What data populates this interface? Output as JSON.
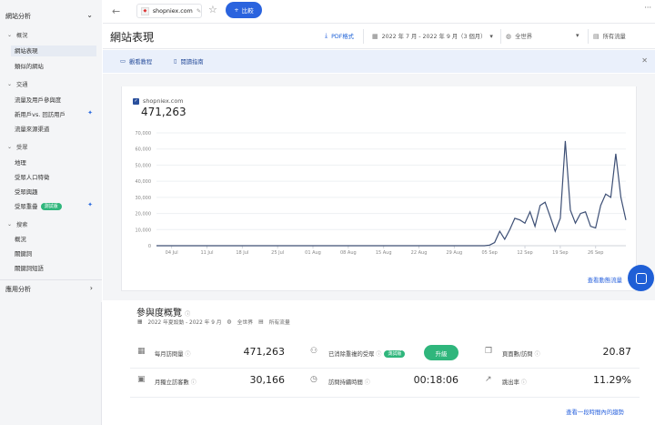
{
  "sidebar": {
    "header": "網站分析",
    "sections": [
      {
        "title": "概況",
        "items": [
          "網站表現",
          "類似的網站"
        ]
      },
      {
        "title": "交通",
        "items": [
          "流量及用戶參與度",
          "新用戶vs. 回訪用戶",
          "流量來源渠道"
        ]
      },
      {
        "title": "受眾",
        "items": [
          "地理",
          "受眾人口特徵",
          "受眾興趣",
          "受眾重疊"
        ]
      },
      {
        "title": "搜索",
        "items": [
          "概況",
          "關鍵詞",
          "關鍵詞短語"
        ]
      }
    ],
    "new_badge": "測試版",
    "footer": "應用分析"
  },
  "topbar": {
    "domain": "shopniex.com",
    "compare_label": "比較",
    "more": "···"
  },
  "titlebar": {
    "title": "網站表現",
    "pdf": "PDF格式",
    "date_range": "2022 年 7 月 - 2022 年 9 月（3 個月）",
    "region": "全世界",
    "traffic": "所有流量"
  },
  "infobar": {
    "tutorial": "觀看教程",
    "guide": "閱讀指南"
  },
  "chart": {
    "legend": "shopniex.com",
    "total": "471,263",
    "link": "查看動態流量"
  },
  "chart_data": {
    "type": "line",
    "series": [
      {
        "name": "shopniex.com"
      }
    ],
    "x_tick_labels": [
      "04 Jul",
      "11 Jul",
      "18 Jul",
      "25 Jul",
      "01 Aug",
      "08 Aug",
      "15 Aug",
      "22 Aug",
      "29 Aug",
      "05 Sep",
      "12 Sep",
      "19 Sep",
      "26 Sep"
    ],
    "y_tick_labels": [
      "0",
      "10,000",
      "20,000",
      "30,000",
      "40,000",
      "50,000",
      "60,000",
      "70,000"
    ],
    "ylim": [
      0,
      70000
    ],
    "x_start": "2022-07-01",
    "x_end": "2022-09-30",
    "points": [
      [
        "2022-07-01",
        0
      ],
      [
        "2022-09-04",
        0
      ],
      [
        "2022-09-05",
        400
      ],
      [
        "2022-09-06",
        2000
      ],
      [
        "2022-09-07",
        9000
      ],
      [
        "2022-09-08",
        4000
      ],
      [
        "2022-09-09",
        10000
      ],
      [
        "2022-09-10",
        17000
      ],
      [
        "2022-09-11",
        16000
      ],
      [
        "2022-09-12",
        14000
      ],
      [
        "2022-09-13",
        21000
      ],
      [
        "2022-09-14",
        12000
      ],
      [
        "2022-09-15",
        25000
      ],
      [
        "2022-09-16",
        27000
      ],
      [
        "2022-09-17",
        18000
      ],
      [
        "2022-09-18",
        9000
      ],
      [
        "2022-09-19",
        17000
      ],
      [
        "2022-09-20",
        65000
      ],
      [
        "2022-09-21",
        22000
      ],
      [
        "2022-09-22",
        14000
      ],
      [
        "2022-09-23",
        20000
      ],
      [
        "2022-09-24",
        21000
      ],
      [
        "2022-09-25",
        12000
      ],
      [
        "2022-09-26",
        11000
      ],
      [
        "2022-09-27",
        25000
      ],
      [
        "2022-09-28",
        32000
      ],
      [
        "2022-09-29",
        30000
      ],
      [
        "2022-09-30",
        57000
      ],
      [
        "2022-10-01",
        30000
      ],
      [
        "2022-10-02",
        16000
      ]
    ],
    "grid": true,
    "line_color": "#3d4f75"
  },
  "engagement": {
    "title": "參與度概覽",
    "subtitle_date": "2022 年夏設動 - 2022 年 9 月",
    "subtitle_region": "全世界",
    "subtitle_traffic": "所有流量",
    "metrics": [
      {
        "label": "每月訪問量",
        "value": "471,263"
      },
      {
        "label": "已消除重複的受眾",
        "value": "",
        "badge": "測試版",
        "button": "升級"
      },
      {
        "label": "頁面數/訪問",
        "value": "20.87"
      },
      {
        "label": "月獨立訪客數",
        "value": "30,166"
      },
      {
        "label": "訪問持續時間",
        "value": "00:18:06"
      },
      {
        "label": "跳出率",
        "value": "11.29%"
      }
    ],
    "link": "查看一段時間內的趨勢"
  }
}
